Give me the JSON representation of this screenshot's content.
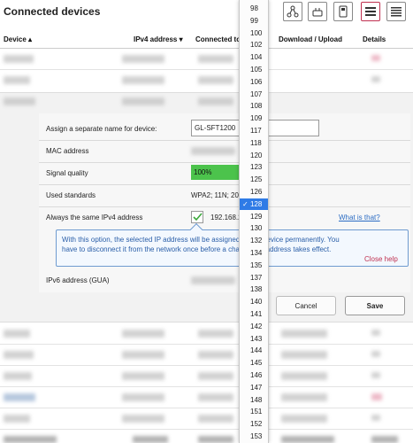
{
  "header": {
    "title": "Connected devices"
  },
  "columns": {
    "device": "Device ▴",
    "ipv4": "IPv4 address ▾",
    "connected": "Connected to",
    "download": "Download / Upload",
    "details": "Details"
  },
  "details": {
    "name_label": "Assign a separate name for device:",
    "name_value": "GL-SFT1200",
    "mac_label": "MAC address",
    "signal_label": "Signal quality",
    "signal_value": "100%",
    "signal_fraction": 1.0,
    "standards_label": "Used standards",
    "standards_value": "WPA2; 11N; 20M",
    "ipv4_label": "Always the same IPv4 address",
    "ipv4_value": "192.168.2.",
    "ipv4_checked": true,
    "help_link": "What is that?",
    "help_text": "With this option, the selected IP address will be assigned to this device permanently. You have to disconnect it from the network once before a changed IP address takes effect.",
    "help_close": "Close help",
    "ipv6_label": "IPv6 address (GUA)",
    "cancel_label": "Cancel",
    "save_label": "Save"
  },
  "dropdown": {
    "options": [
      "98",
      "99",
      "100",
      "102",
      "104",
      "105",
      "106",
      "107",
      "108",
      "109",
      "117",
      "118",
      "120",
      "123",
      "125",
      "126",
      "128",
      "129",
      "130",
      "132",
      "134",
      "135",
      "137",
      "138",
      "140",
      "141",
      "142",
      "143",
      "144",
      "145",
      "146",
      "147",
      "148",
      "151",
      "152",
      "153"
    ],
    "selected": "128",
    "check_glyph": "✓"
  },
  "colors": {
    "accent": "#c03050",
    "selected_option": "#2f7be6",
    "signal": "#4cc34c",
    "help_text": "#2a5ea8",
    "link": "#2b6cc4"
  }
}
